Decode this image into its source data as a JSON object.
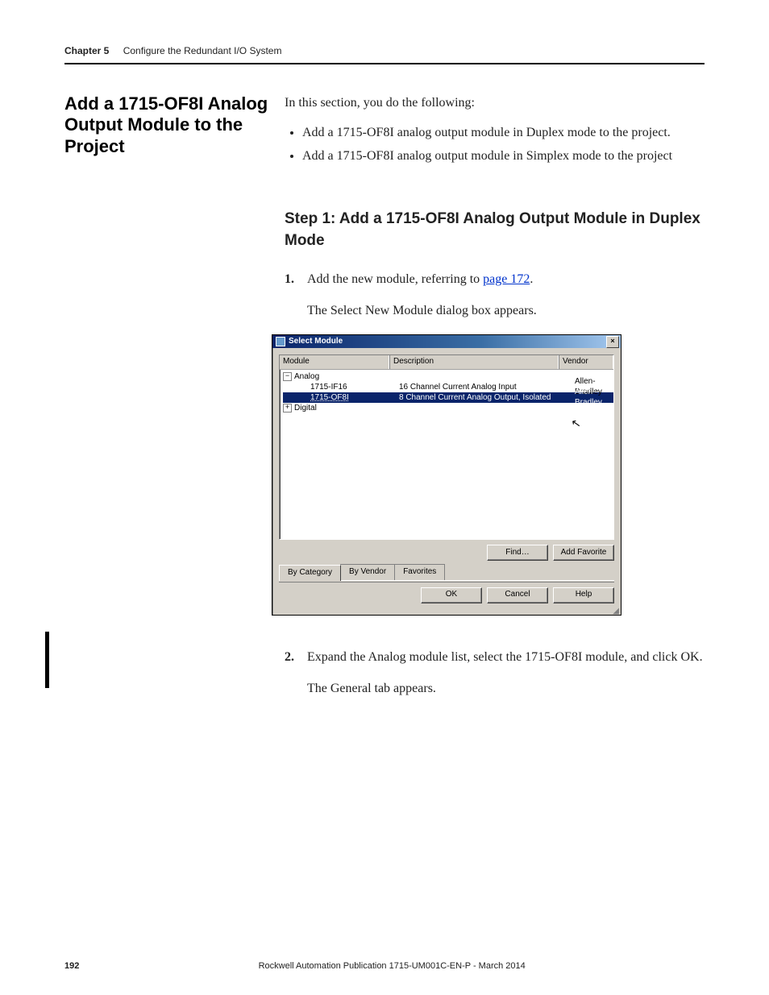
{
  "running_head": {
    "chapter": "Chapter 5",
    "title": "Configure the Redundant I/O System"
  },
  "sidehead": "Add a 1715-OF8I Analog Output Module to the Project",
  "intro": "In this section, you do the following:",
  "bullets": [
    "Add a 1715-OF8I analog output module in Duplex mode to the project.",
    "Add a 1715-OF8I analog output module in Simplex mode to the project"
  ],
  "step_heading": "Step 1: Add a 1715-OF8I Analog Output Module in Duplex Mode",
  "steps": {
    "s1_num": "1.",
    "s1_text_a": "Add the new module, referring to ",
    "s1_link": "page 172",
    "s1_text_b": ".",
    "s1_para2": "The Select New Module dialog box appears.",
    "s2_num": "2.",
    "s2_text": "Expand the Analog module list, select the 1715-OF8I module, and click OK.",
    "s2_para2": "The General tab appears."
  },
  "dialog": {
    "title": "Select Module",
    "columns": {
      "module": "Module",
      "description": "Description",
      "vendor": "Vendor"
    },
    "tree": {
      "analog_label": "Analog",
      "analog_expander": "−",
      "item1": {
        "name": "1715-IF16",
        "desc": "16 Channel Current Analog Input",
        "vendor": "Allen-Bradley"
      },
      "item2": {
        "name": "1715-OF8I",
        "desc": "8 Channel Current Analog Output, Isolated",
        "vendor": "Allen-Bradley"
      },
      "digital_label": "Digital",
      "digital_expander": "+"
    },
    "buttons": {
      "find": "Find…",
      "add_fav": "Add Favorite",
      "ok": "OK",
      "cancel": "Cancel",
      "help": "Help"
    },
    "tabs": {
      "by_category": "By Category",
      "by_vendor": "By Vendor",
      "favorites": "Favorites"
    },
    "close_x": "×"
  },
  "footer": {
    "page": "192",
    "publication": "Rockwell Automation Publication 1715-UM001C-EN-P - March 2014"
  }
}
